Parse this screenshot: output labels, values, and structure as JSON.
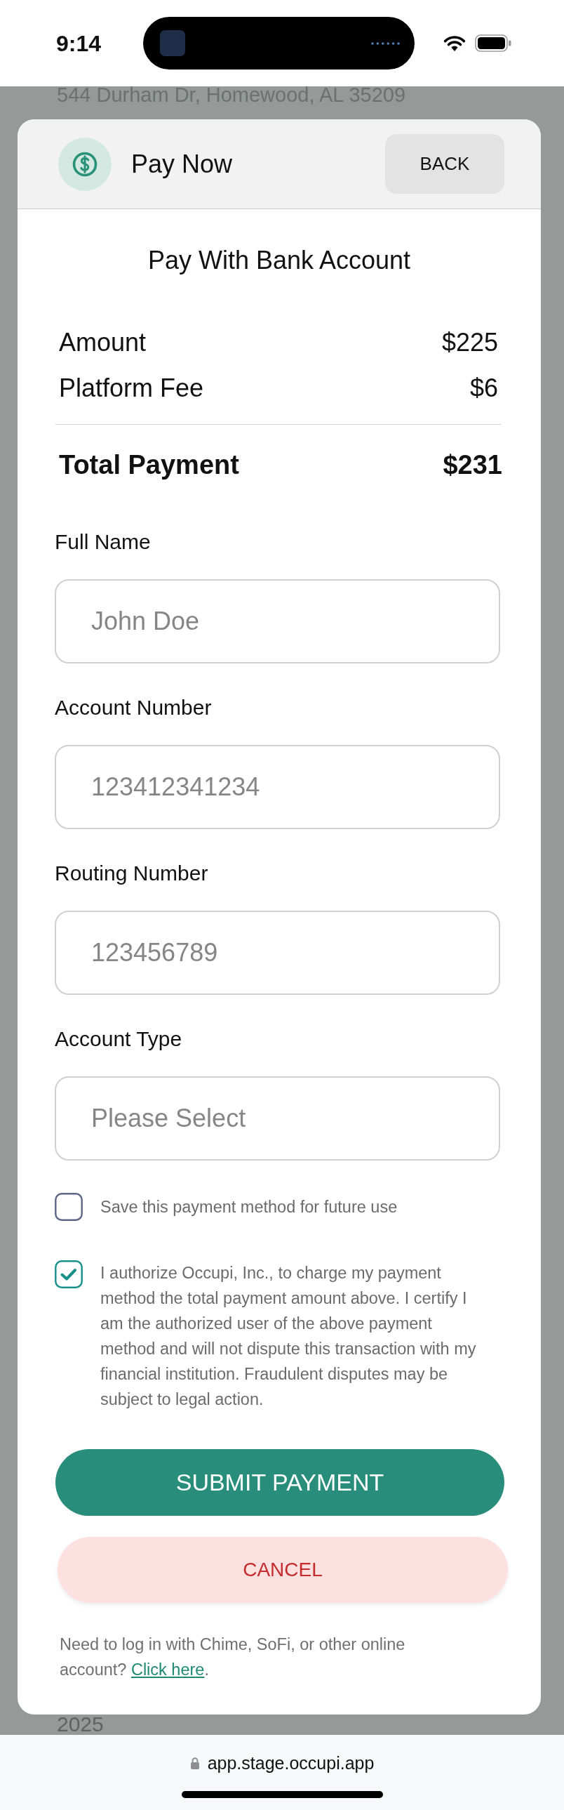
{
  "status_bar": {
    "time": "9:14"
  },
  "background_page": {
    "address": "544 Durham Dr, Homewood, AL 35209",
    "year": "2025"
  },
  "payment_modal": {
    "title": "Pay Now",
    "back_button": "BACK",
    "heading": "Pay With Bank Account",
    "summary": [
      {
        "label": "Amount",
        "value": "$225"
      },
      {
        "label": "Platform Fee",
        "value": "$6"
      }
    ],
    "total": {
      "label": "Total Payment",
      "value": "$231"
    },
    "fields": [
      {
        "label": "Full Name",
        "placeholder": "John Doe"
      },
      {
        "label": "Account Number",
        "placeholder": "123412341234"
      },
      {
        "label": "Routing Number",
        "placeholder": "123456789"
      },
      {
        "label": "Account Type",
        "placeholder": "Please Select"
      }
    ],
    "checkboxes": [
      {
        "label": "Save this payment method for future use",
        "checked": false
      },
      {
        "label": "I authorize Occupi, Inc., to charge my payment method the total payment amount above. I certify I am the authorized user of the above payment method and will not dispute this transaction with my financial institution. Fraudulent disputes may be subject to legal action.",
        "checked": true
      }
    ],
    "submit_button": "SUBMIT PAYMENT",
    "cancel_button": "CANCEL",
    "help": {
      "text": "Need to log in with Chime, SoFi, or other online account?",
      "link": "Click here",
      "end": "."
    }
  },
  "browser_bar": {
    "url": "app.stage.occupi.app"
  }
}
